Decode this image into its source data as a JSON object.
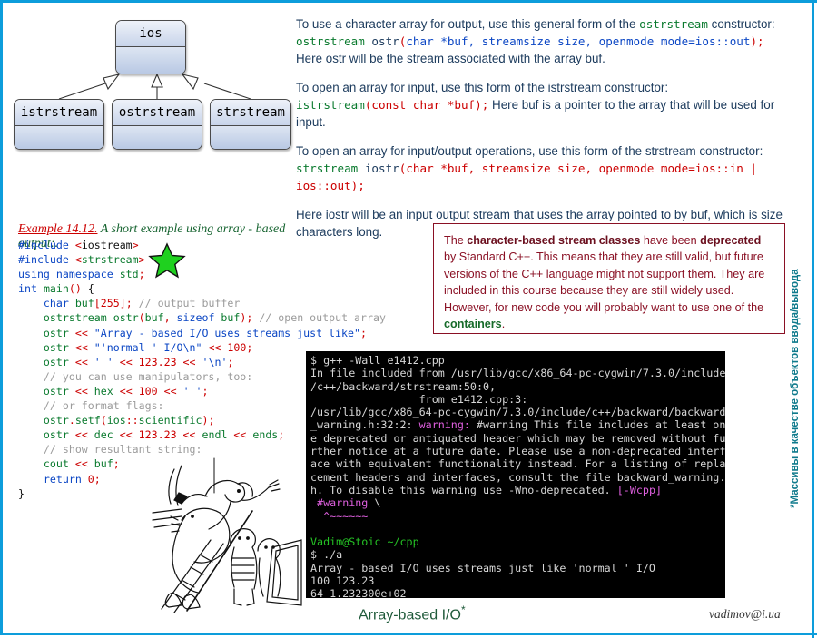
{
  "theme": {
    "frame": "#0d9ddb",
    "accent_green": "#0a7a2e",
    "accent_red": "#cc0000",
    "accent_blue": "#0b46c4",
    "note_border": "#8a1024"
  },
  "diagram": {
    "base_class": "ios",
    "derived": [
      "istrstream",
      "ostrstream",
      "strstream"
    ],
    "relation": "inheritance"
  },
  "prose": {
    "p1": {
      "line1_a": "To use a character array for output, use this general form of the ",
      "line1_code": "ostrstream",
      "line1_b": " constructor:",
      "sig_name": "ostrstream",
      "sig_fn": " ostr",
      "sig_paren_open": "(",
      "sig_args": "char *buf, streamsize size, openmode mode=ios::out",
      "sig_paren_close": ");",
      "line3": "Here ostr will be the stream associated with the array buf."
    },
    "p2": {
      "line1": "To open an array for input, use this form of the istrstream constructor:",
      "sig_name": "istrstream",
      "sig_args": "(const char *buf);",
      "tail": "  Here buf is a pointer to the array that will be used for input."
    },
    "p3": {
      "line1": "To open an array for input/output operations, use this form of the strstream constructor:",
      "sig_name": "strstream",
      "sig_fn": " iostr",
      "sig_args": "(char *buf, streamsize size, openmode mode=ios::in | ios::out);"
    },
    "p4": "Here iostr will be an input output stream that uses the array pointed to by buf, which is size characters long."
  },
  "example": {
    "number": "Example 14.12.",
    "title": "A short example using array - based output:.",
    "code_lines": [
      "#include <iostream>",
      "#include <strstream>",
      "using namespace std;",
      "int main() {",
      "    char buf[255]; // output buffer",
      "    ostrstream ostr(buf, sizeof buf); // open output array",
      "    ostr << \"Array - based I/O uses streams just like\";",
      "    ostr << \"'normal ' I/O\\n\" << 100;",
      "    ostr << ' ' << 123.23 << '\\n';",
      "    // you can use manipulators, too:",
      "    ostr << hex << 100 << ' ';",
      "    // or format flags:",
      "    ostr.setf(ios::scientific);",
      "    ostr << dec << 123.23 << endl << ends;",
      "    // show resultant string:",
      "    cout << buf;",
      "    return 0;",
      "}"
    ],
    "marker_icon": "green-star-icon"
  },
  "note": {
    "t1": "The ",
    "b1": "character-based stream classes",
    "t2": " have been ",
    "b2": "deprecated",
    "t3": " by Standard C++.  This means that they are still valid, but future versions of the C++ language might not support them.  They are included in this course because they are still widely used. However, for new code you will probably want to use one of the ",
    "b3": "containers",
    "t4": "."
  },
  "terminal": {
    "lines": [
      "$ g++ -Wall e1412.cpp",
      "In file included from /usr/lib/gcc/x86_64-pc-cygwin/7.3.0/include",
      "/c++/backward/strstream:50:0,",
      "                 from e1412.cpp:3:",
      "/usr/lib/gcc/x86_64-pc-cygwin/7.3.0/include/c++/backward/backward",
      "_warning.h:32:2: warning: #warning This file includes at least on",
      "e deprecated or antiquated header which may be removed without fu",
      "rther notice at a future date. Please use a non-deprecated interf",
      "ace with equivalent functionality instead. For a listing of repla",
      "cement headers and interfaces, consult the file backward_warning.",
      "h. To disable this warning use -Wno-deprecated. [-Wcpp]",
      " #warning \\",
      "  ^~~~~~~",
      "",
      "Vadim@Stoic ~/cpp",
      "$ ./a",
      "Array - based I/O uses streams just like 'normal ' I/O",
      "100 123.23",
      "64 1.232300e+02"
    ],
    "warning_token": "warning:",
    "flag_token": "[-Wcpp]",
    "prompt_host": "Vadim@Stoic ~/cpp",
    "run_command": "$ ./a",
    "program_output": [
      "Array - based I/O uses streams just like 'normal ' I/O",
      "100 123.23",
      "64 1.232300e+02"
    ]
  },
  "footer": {
    "title": "Array-based I/O",
    "title_mark": "*",
    "email": "vadimov@i.ua"
  },
  "side_caption": "*Массивы в качестве объектов ввода/вывода"
}
